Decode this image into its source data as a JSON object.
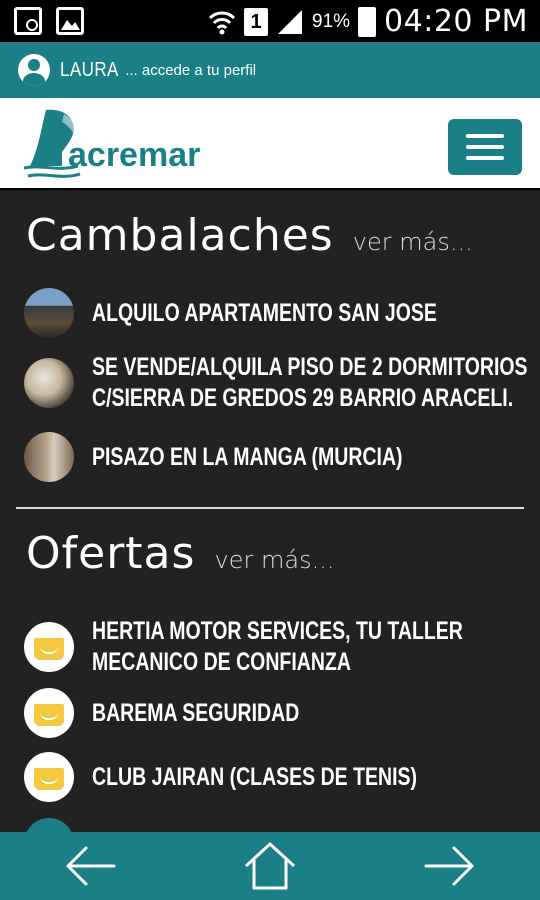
{
  "status_bar": {
    "sim_slot": "1",
    "battery_percent": "91%",
    "time": "04:20 PM",
    "icons": [
      "screenshot-icon",
      "gallery-icon",
      "wifi-icon",
      "sim-icon",
      "signal-icon",
      "battery-icon"
    ]
  },
  "profile": {
    "user_name": "LAURA",
    "link_text": "... accede a tu perfil"
  },
  "header": {
    "logo_text": "acremar",
    "menu_icon": "hamburger-icon"
  },
  "cambalaches": {
    "title": "Cambalaches",
    "more_label": "ver más...",
    "items": [
      {
        "text": "ALQUILO APARTAMENTO SAN JOSE"
      },
      {
        "line1": "SE VENDE/ALQUILA PISO DE 2 DORMITORIOS",
        "line2": "C/SIERRA DE GREDOS 29 BARRIO ARACELI."
      },
      {
        "text": "PISAZO EN LA MANGA (MURCIA)"
      }
    ]
  },
  "ofertas": {
    "title": "Ofertas",
    "more_label": "ver más...",
    "items": [
      {
        "line1": "HERTIA MOTOR SERVICES, TU TALLER",
        "line2": "MECANICO DE CONFIANZA"
      },
      {
        "text": "BAREMA SEGURIDAD"
      },
      {
        "text": "CLUB JAIRAN (CLASES DE TENIS)"
      }
    ]
  },
  "nav": {
    "icons": [
      "back-arrow-icon",
      "home-icon",
      "forward-arrow-icon"
    ]
  },
  "colors": {
    "accent": "#1a7f86",
    "offer_icon": "#f5c842",
    "background": "#222222"
  }
}
